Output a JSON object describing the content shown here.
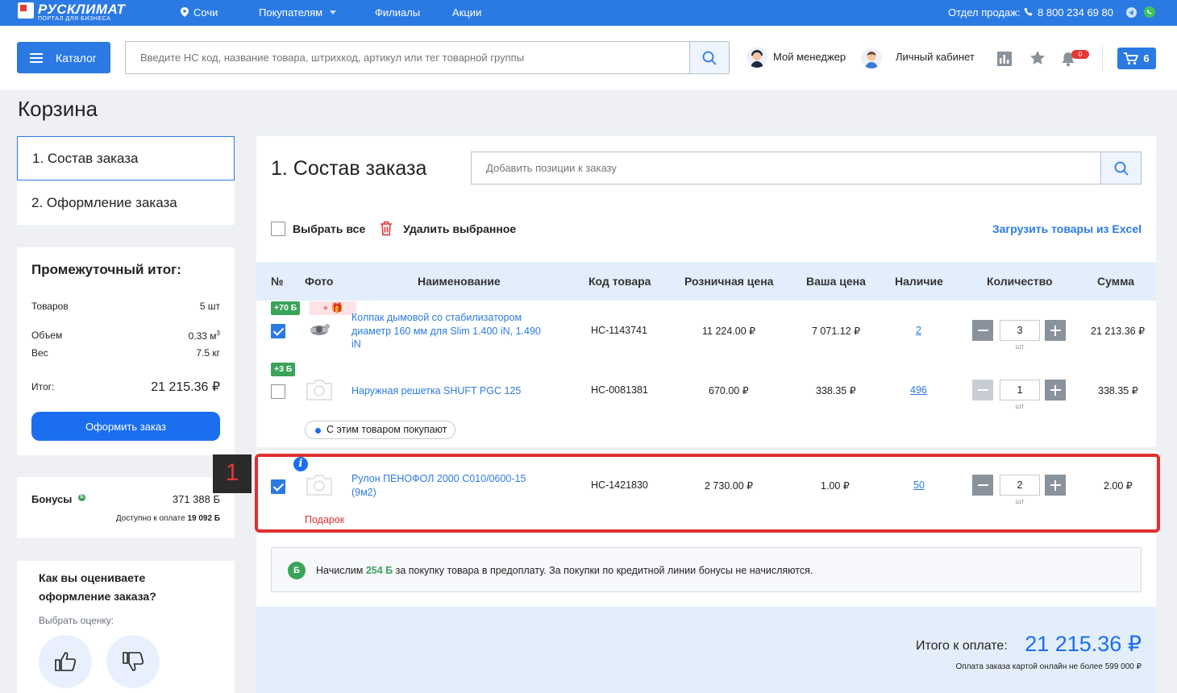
{
  "topbar": {
    "logo_text": "РУСКЛИМАТ",
    "logo_subtitle": "ПОРТАЛ ДЛЯ БИЗНЕСА",
    "city": "Сочи",
    "buyers": "Покупателям",
    "branches": "Филиалы",
    "promos": "Акции",
    "sales_label": "Отдел продаж:",
    "phone": "8 800 234 69 80"
  },
  "header": {
    "catalog_label": "Каталог",
    "search_placeholder": "Введите НС код, название товара, штрихкод, артикул или тег товарной группы",
    "manager_label": "Мой менеджер",
    "account_label": "Личный кабинет",
    "notifications_count": "0",
    "cart_count": "6"
  },
  "page_title": "Корзина",
  "steps": [
    {
      "label": "1. Состав заказа",
      "active": true
    },
    {
      "label": "2. Оформление заказа",
      "active": false
    }
  ],
  "summary": {
    "title": "Промежуточный итог:",
    "items_label": "Товаров",
    "items_value": "5 шт",
    "volume_label": "Объем",
    "volume_value": "0.33 м",
    "volume_sup": "3",
    "weight_label": "Вес",
    "weight_value": "7.5 кг",
    "total_label": "Итог:",
    "total_value": "21 215.36 ₽",
    "order_button": "Оформить заказ"
  },
  "bonuses": {
    "label": "Бонусы",
    "badge": "Б",
    "value": "371 388 Б",
    "available_label": "Доступно к оплате",
    "available_value": "19 092 Б"
  },
  "rating": {
    "question": "Как вы оцениваете оформление заказа?",
    "hint": "Выбрать оценку:"
  },
  "main": {
    "title": "1. Состав заказа",
    "add_placeholder": "Добавить позиции к заказу",
    "select_all": "Выбрать все",
    "delete_selected": "Удалить выбранное",
    "upload_excel": "Загрузить товары из Excel",
    "columns": [
      "№",
      "Фото",
      "Наименование",
      "Код товара",
      "Розничная цена",
      "Ваша цена",
      "Наличие",
      "Количество",
      "Сумма"
    ],
    "rows": [
      {
        "checked": true,
        "bonus": "+70 Б",
        "gift_tag": "+ 🎁",
        "name": "Колпак дымовой со стабилизатором диаметр 160 мм для Slim 1.400 iN, 1.490 iN",
        "code": "НС-1143741",
        "retail": "11 224.00 ₽",
        "price": "7 071.12 ₽",
        "stock": "2",
        "qty": "3",
        "unit": "шт",
        "sum": "21 213.36 ₽"
      },
      {
        "checked": false,
        "bonus": "+3 Б",
        "name": "Наружная решетка SHUFT PGC 125",
        "code": "НС-0081381",
        "retail": "670.00 ₽",
        "price": "338.35 ₽",
        "stock": "496",
        "qty": "1",
        "unit": "шт",
        "sum": "338.35 ₽"
      },
      {
        "checked": true,
        "name": "Рулон ПЕНОФОЛ 2000 С010/0600-15 (9м2)",
        "code": "НС-1421830",
        "retail": "2 730.00 ₽",
        "price": "1.00 ₽",
        "stock": "50",
        "qty": "2",
        "unit": "шт",
        "sum": "2.00 ₽",
        "gift_label": "Подарок"
      }
    ],
    "buy_with": "С этим товаром покупают",
    "marker_number": "1",
    "info_icon": "i",
    "note": {
      "badge": "Б",
      "prefix": "Начислим",
      "bonus": "254 Б",
      "suffix": "за покупку товара в предоплату. За покупки по кредитной линии бонусы не начисляются."
    },
    "total_label": "Итого к оплате:",
    "total_value": "21 215.36 ₽",
    "card_limit": "Оплата заказа картой онлайн не более 599 000 ₽"
  },
  "colors": {
    "primary": "#2b7ae4",
    "bonus_green": "#3aa35a",
    "highlight_red": "#e0302f"
  }
}
